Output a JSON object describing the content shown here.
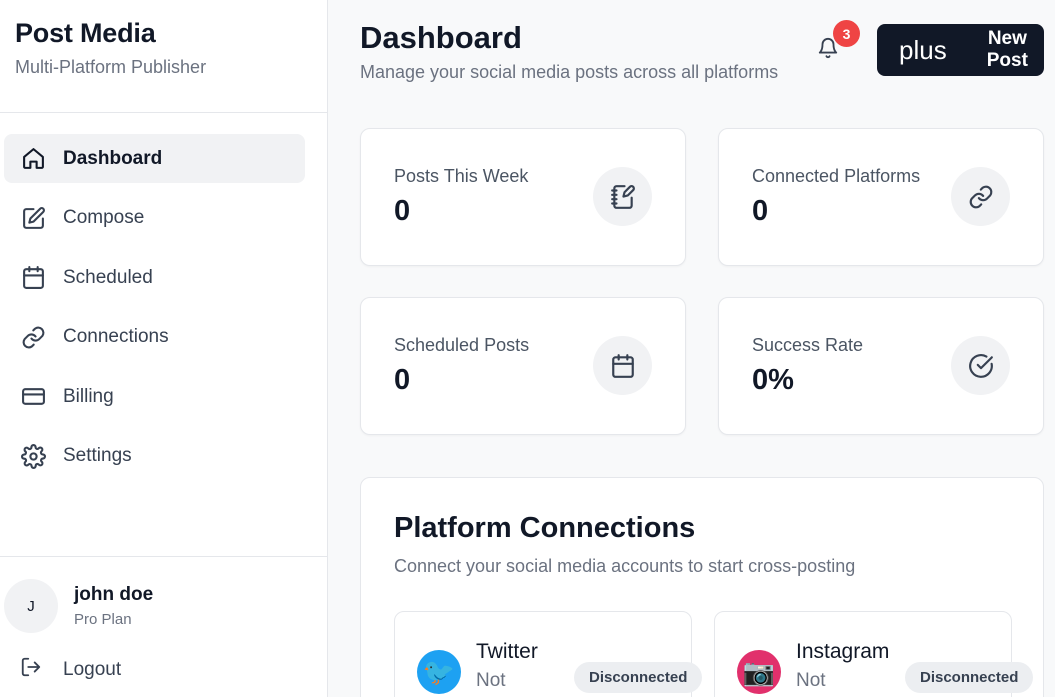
{
  "brand": {
    "title": "Post Media",
    "subtitle": "Multi-Platform Publisher"
  },
  "nav": {
    "items": [
      {
        "label": "Dashboard",
        "icon": "home-icon",
        "active": true
      },
      {
        "label": "Compose",
        "icon": "edit-icon"
      },
      {
        "label": "Scheduled",
        "icon": "calendar-icon"
      },
      {
        "label": "Connections",
        "icon": "link-icon"
      },
      {
        "label": "Billing",
        "icon": "credit-card-icon"
      },
      {
        "label": "Settings",
        "icon": "gear-icon"
      }
    ]
  },
  "user": {
    "initial": "J",
    "name": "john doe",
    "plan": "Pro Plan"
  },
  "logout": {
    "label": "Logout"
  },
  "header": {
    "title": "Dashboard",
    "subtitle": "Manage your social media posts across all platforms",
    "notification_count": "3",
    "new_post_label": "New Post",
    "new_post_icon": "plus"
  },
  "stats": [
    {
      "label": "Posts This Week",
      "value": "0",
      "icon": "notebook-pen-icon"
    },
    {
      "label": "Connected Platforms",
      "value": "0",
      "icon": "link-icon"
    },
    {
      "label": "Scheduled Posts",
      "value": "0",
      "icon": "calendar-icon"
    },
    {
      "label": "Success Rate",
      "value": "0%",
      "icon": "check-circle-icon"
    }
  ],
  "platforms": {
    "title": "Platform Connections",
    "subtitle": "Connect your social media accounts to start cross-posting",
    "items": [
      {
        "name": "Twitter",
        "status": "Not",
        "badge": "Disconnected",
        "logo": "🐦",
        "color": "#1da1f2"
      },
      {
        "name": "Instagram",
        "status": "Not",
        "badge": "Disconnected",
        "logo": "📷",
        "color": "#e1306c"
      }
    ]
  },
  "colors": {
    "accent": "#111827",
    "badge_red": "#ef4444",
    "muted": "#6b7280"
  }
}
